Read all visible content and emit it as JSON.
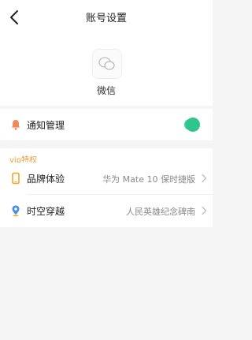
{
  "header": {
    "title": "账号设置"
  },
  "app": {
    "name": "微信",
    "icon": "wechat-icon"
  },
  "notification": {
    "label": "通知管理",
    "icon": "bell-icon",
    "enabled": true,
    "accent": "#36d39b"
  },
  "vip": {
    "section_label": "vip特权",
    "section_color": "#e8a03a",
    "items": [
      {
        "label": "品牌体验",
        "value": "华为 Mate 10 保时捷版",
        "icon": "phone-icon"
      },
      {
        "label": "时空穿越",
        "value": "人民英雄纪念碑南",
        "icon": "location-pin-icon"
      }
    ]
  }
}
